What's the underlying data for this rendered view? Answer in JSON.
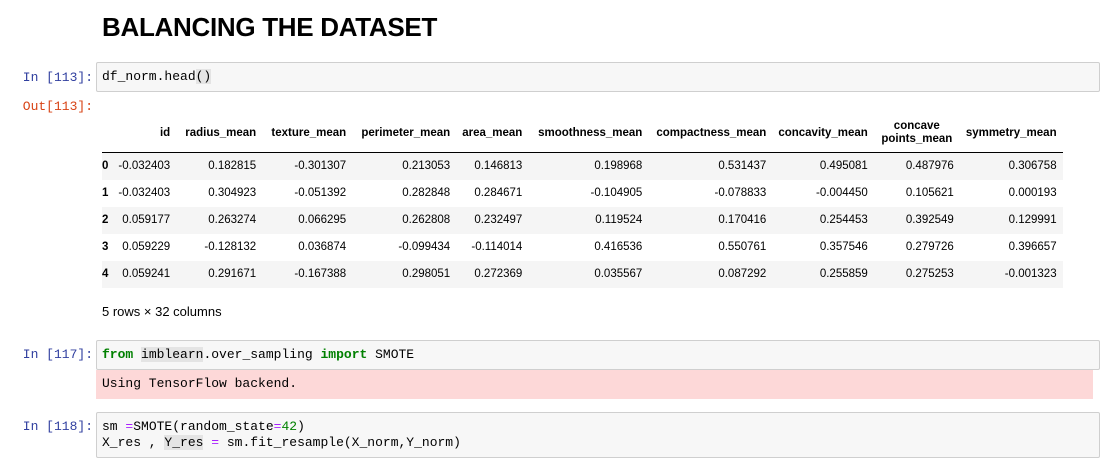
{
  "heading": "BALANCING THE DATASET",
  "cells": {
    "c113": {
      "in_prompt": "In [113]:",
      "out_prompt": "Out[113]:",
      "code_a": "df_norm.head",
      "code_b": "()"
    },
    "c117": {
      "in_prompt": "In [117]:",
      "kw_from": "from",
      "module": "imblearn",
      "module_rest": ".over_sampling ",
      "kw_import": "import",
      "name": " SMOTE",
      "stderr": "Using TensorFlow backend."
    },
    "c118": {
      "in_prompt": "In [118]:",
      "l1_a": "sm ",
      "l1_eq": "=",
      "l1_b": "SMOTE(random_state",
      "l1_eq2": "=",
      "l1_num": "42",
      "l1_c": ")",
      "l2_a": "X_res , ",
      "l2_yres": "Y_res",
      "l2_sp": " ",
      "l2_eq": "=",
      "l2_b": " sm.fit_resample(X_norm,Y_norm)"
    }
  },
  "dataframe": {
    "columns": [
      "id",
      "radius_mean",
      "texture_mean",
      "perimeter_mean",
      "area_mean",
      "smoothness_mean",
      "compactness_mean",
      "concavity_mean",
      "concave points_mean",
      "symmetry_mean"
    ],
    "rows": [
      {
        "index": "0",
        "values": [
          "-0.032403",
          "0.182815",
          "-0.301307",
          "0.213053",
          "0.146813",
          "0.198968",
          "0.531437",
          "0.495081",
          "0.487976",
          "0.306758"
        ]
      },
      {
        "index": "1",
        "values": [
          "-0.032403",
          "0.304923",
          "-0.051392",
          "0.282848",
          "0.284671",
          "-0.104905",
          "-0.078833",
          "-0.004450",
          "0.105621",
          "0.000193"
        ]
      },
      {
        "index": "2",
        "values": [
          "0.059177",
          "0.263274",
          "0.066295",
          "0.262808",
          "0.232497",
          "0.119524",
          "0.170416",
          "0.254453",
          "0.392549",
          "0.129991"
        ]
      },
      {
        "index": "3",
        "values": [
          "0.059229",
          "-0.128132",
          "0.036874",
          "-0.099434",
          "-0.114014",
          "0.416536",
          "0.550761",
          "0.357546",
          "0.279726",
          "0.396657"
        ]
      },
      {
        "index": "4",
        "values": [
          "0.059241",
          "0.291671",
          "-0.167388",
          "0.298051",
          "0.272369",
          "0.035567",
          "0.087292",
          "0.255859",
          "0.275253",
          "-0.001323"
        ]
      }
    ],
    "summary": "5 rows × 32 columns"
  }
}
